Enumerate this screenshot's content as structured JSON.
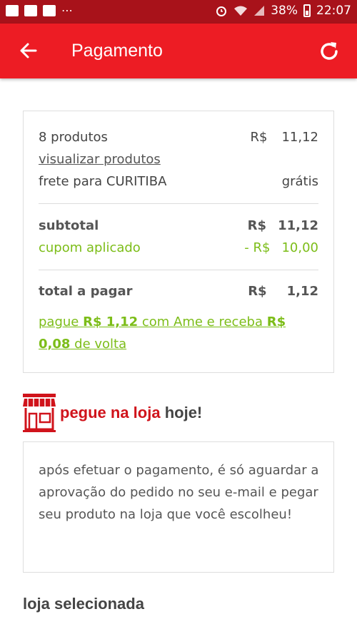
{
  "status_bar": {
    "icons_left": [
      "notification-icon",
      "gallery-icon",
      "vpn-icon"
    ],
    "more": "⋯",
    "battery_percent": "38%",
    "time": "22:07"
  },
  "app_bar": {
    "title": "Pagamento",
    "back_icon": "arrow-left-icon",
    "refresh_icon": "refresh-icon",
    "background": "#ed1c24"
  },
  "summary": {
    "products_label": "8 produtos",
    "products_currency": "R$",
    "products_value": "11,12",
    "view_products_link": "visualizar produtos",
    "shipping_label": "frete para CURITIBA",
    "shipping_value": "grátis",
    "subtotal_label": "subtotal",
    "subtotal_currency": "R$",
    "subtotal_value": "11,12",
    "coupon_label": "cupom aplicado",
    "coupon_currency": "- R$",
    "coupon_value": "10,00",
    "total_label": "total a pagar",
    "total_currency": "R$",
    "total_value": "1,12",
    "ame_text_1": "pague ",
    "ame_amount": "R$ 1,12",
    "ame_text_2": " com Ame e receba ",
    "ame_cashback": "R$ 0,08",
    "ame_text_3": " de volta",
    "green_color": "#7cbd18"
  },
  "store_pickup": {
    "icon": "store-icon",
    "title_highlight": "pegue na loja",
    "title_rest": " hoje!",
    "info_text": "após efetuar o pagamento, é só aguardar a aprovação do pedido no seu e-mail e pegar seu produto na loja que você escolheu!"
  },
  "selected_store": {
    "heading": "loja selecionada"
  }
}
